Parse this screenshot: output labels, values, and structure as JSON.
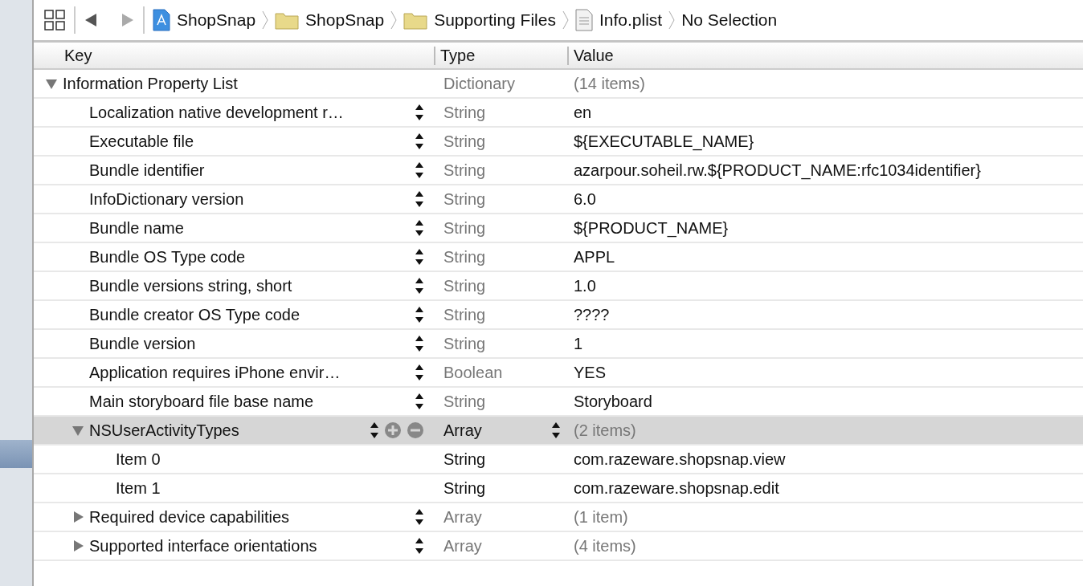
{
  "toolbar": {
    "breadcrumbs": [
      {
        "kind": "project",
        "label": "ShopSnap"
      },
      {
        "kind": "folder",
        "label": "ShopSnap"
      },
      {
        "kind": "folder",
        "label": "Supporting Files"
      },
      {
        "kind": "plist",
        "label": "Info.plist"
      },
      {
        "kind": "text",
        "label": "No Selection"
      }
    ]
  },
  "table": {
    "columns": [
      "Key",
      "Type",
      "Value"
    ],
    "rows": [
      {
        "key": "Information Property List",
        "type": "Dictionary",
        "value": "(14 items)",
        "selected": false,
        "expanded": true,
        "children": [
          {
            "key": "Localization native development r…",
            "type": "String",
            "value": "en",
            "selected": false
          },
          {
            "key": "Executable file",
            "type": "String",
            "value": "${EXECUTABLE_NAME}",
            "selected": false
          },
          {
            "key": "Bundle identifier",
            "type": "String",
            "value": "azarpour.soheil.rw.${PRODUCT_NAME:rfc1034identifier}",
            "selected": false
          },
          {
            "key": "InfoDictionary version",
            "type": "String",
            "value": "6.0",
            "selected": false
          },
          {
            "key": "Bundle name",
            "type": "String",
            "value": "${PRODUCT_NAME}",
            "selected": false
          },
          {
            "key": "Bundle OS Type code",
            "type": "String",
            "value": "APPL",
            "selected": false
          },
          {
            "key": "Bundle versions string, short",
            "type": "String",
            "value": "1.0",
            "selected": false
          },
          {
            "key": "Bundle creator OS Type code",
            "type": "String",
            "value": "????",
            "selected": false
          },
          {
            "key": "Bundle version",
            "type": "String",
            "value": "1",
            "selected": false
          },
          {
            "key": "Application requires iPhone envir…",
            "type": "Boolean",
            "value": "YES",
            "selected": false
          },
          {
            "key": "Main storyboard file base name",
            "type": "String",
            "value": "Storyboard",
            "selected": false
          },
          {
            "key": "NSUserActivityTypes",
            "type": "Array",
            "value": "(2 items)",
            "selected": true,
            "expanded": true,
            "children": [
              {
                "key": "Item 0",
                "type": "String",
                "value": "com.razeware.shopsnap.view",
                "selected": false
              },
              {
                "key": "Item 1",
                "type": "String",
                "value": "com.razeware.shopsnap.edit",
                "selected": false
              }
            ]
          },
          {
            "key": "Required device capabilities",
            "type": "Array",
            "value": "(1 item)",
            "selected": false,
            "expanded": false
          },
          {
            "key": "Supported interface orientations",
            "type": "Array",
            "value": "(4 items)",
            "selected": false,
            "expanded": false
          }
        ]
      }
    ]
  }
}
